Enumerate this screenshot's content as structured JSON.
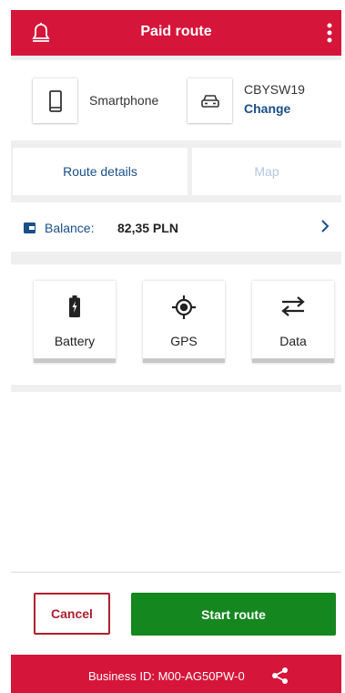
{
  "header": {
    "title": "Paid route",
    "bell_icon": "bell-icon",
    "menu_icon": "more-vertical-icon"
  },
  "device": {
    "label": "Smartphone",
    "icon": "smartphone-icon"
  },
  "vehicle": {
    "plate": "CBYSW19",
    "change_label": "Change",
    "icon": "car-icon"
  },
  "tabs": [
    {
      "label": "Route details",
      "active": true
    },
    {
      "label": "Map",
      "active": false
    }
  ],
  "balance": {
    "label": "Balance:",
    "value": "82,35 PLN",
    "icon": "wallet-icon"
  },
  "checks": [
    {
      "label": "Battery",
      "icon": "battery-charging-icon"
    },
    {
      "label": "GPS",
      "icon": "gps-icon"
    },
    {
      "label": "Data",
      "icon": "data-transfer-icon"
    }
  ],
  "actions": {
    "cancel_label": "Cancel",
    "start_label": "Start route"
  },
  "footer": {
    "business_id": "Business ID:  M00-AG50PW-0",
    "share_icon": "share-icon"
  },
  "colors": {
    "brand_red": "#d6153a",
    "primary_blue": "#1a4f8a",
    "start_green": "#15871f",
    "cancel_red": "#b01e2e"
  }
}
